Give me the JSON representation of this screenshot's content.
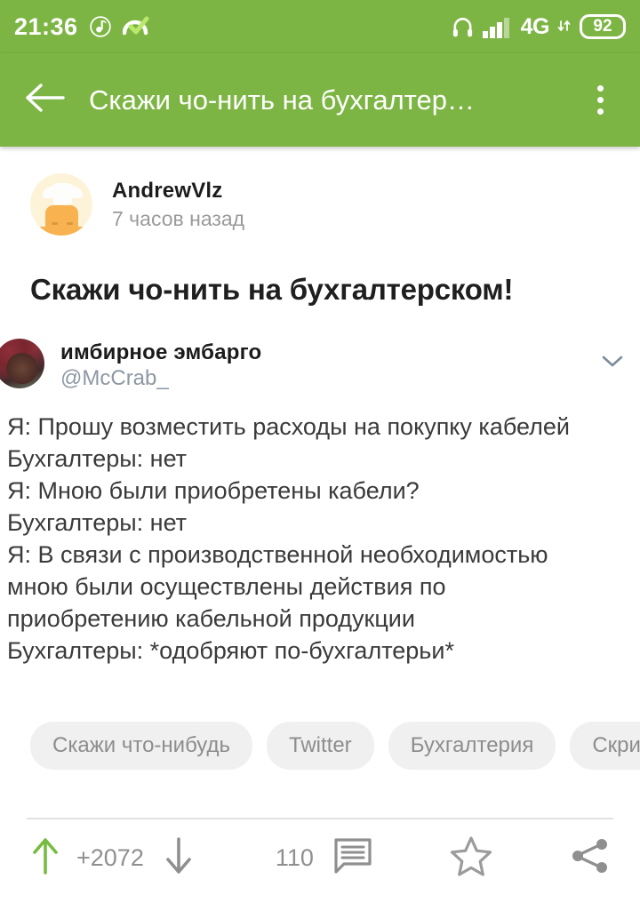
{
  "status_bar": {
    "time": "21:36",
    "left_icons": [
      "music-note-icon",
      "speedometer-check-icon"
    ],
    "right_icons": [
      "headphones-icon",
      "signal-bars-icon",
      "data-transfer-icon"
    ],
    "network_label": "4G",
    "battery_level": "92",
    "background_color": "#7db544"
  },
  "app_bar": {
    "back_icon": "back-arrow-icon",
    "title": "Скажи чо-нить на бухгалтер…",
    "overflow_icon": "overflow-menu-icon",
    "background_color": "#7db544"
  },
  "post": {
    "author": {
      "name": "AndrewVlz",
      "time": "7 часов назад",
      "avatar_icon": "chef-character-avatar"
    },
    "title": "Скажи чо-нить на бухгалтерском!",
    "tweet": {
      "display_name": "имбирное эмбарго",
      "handle": "@McCrab_",
      "avatar_icon": "twitter-profile-avatar",
      "expand_icon": "chevron-down-icon",
      "lines": [
        "Я: Прошу возместить расходы на покупку кабелей",
        "Бухгалтеры: нет",
        "Я: Мною были приобретены кабели?",
        "Бухгалтеры: нет",
        "Я: В связи с производственной необходимостью",
        "мною были осуществлены действия по",
        "приобретению кабельной продукции",
        "Бухгалтеры: *одобряют по-бухгалтерьи*"
      ]
    },
    "tags": [
      "Скажи что-нибудь",
      "Twitter",
      "Бухгалтерия",
      "Скриншот"
    ],
    "actions": {
      "upvote_icon": "upvote-arrow-icon",
      "rating": "+2072",
      "downvote_icon": "downvote-arrow-icon",
      "comments_count": "110",
      "comments_icon": "comment-bubble-icon",
      "favorite_icon": "star-outline-icon",
      "share_icon": "share-icon",
      "upvote_color": "#77bb41",
      "muted_color": "#8f8f8f"
    }
  }
}
